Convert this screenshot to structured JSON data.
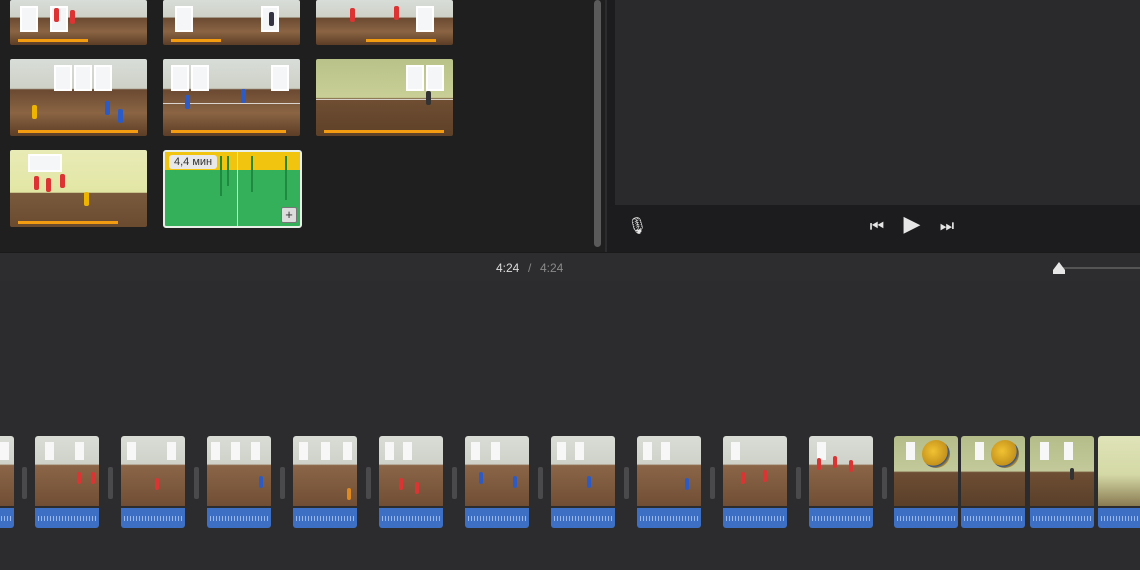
{
  "browser": {
    "audio_clip": {
      "duration": "4,4 мин",
      "add_label": "+"
    }
  },
  "viewer": {
    "icons": {
      "mic": "🎙",
      "prev": "⏮",
      "play": "▶",
      "next": "⏭"
    }
  },
  "timebar": {
    "current": "4:24",
    "separator": "/",
    "total": "4:24"
  },
  "colors": {
    "audio_clip": "#35b05a",
    "audio_wave": "#f1c40f",
    "clip_audio": "#3d6fc4",
    "marker": "#f39c12"
  }
}
